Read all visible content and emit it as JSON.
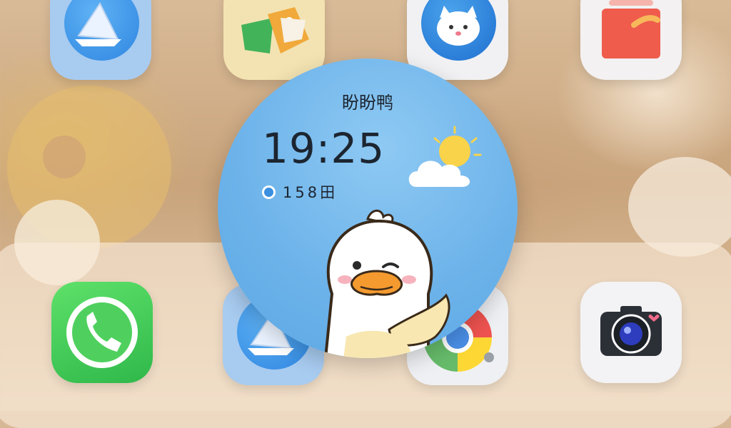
{
  "home": {
    "apps_top": [
      {
        "id": "mail-top",
        "icon": "mail-icon"
      },
      {
        "id": "tag-top",
        "icon": "price-tag-icon"
      },
      {
        "id": "cat-top",
        "icon": "cat-app-icon"
      },
      {
        "id": "gallery-top",
        "icon": "gallery-icon"
      }
    ],
    "dock": [
      {
        "id": "phone",
        "icon": "phone-icon"
      },
      {
        "id": "mail",
        "icon": "mail-icon"
      },
      {
        "id": "browser",
        "icon": "browser-icon"
      },
      {
        "id": "camera",
        "icon": "camera-icon"
      }
    ]
  },
  "widget": {
    "name": "盼盼鸭",
    "time": "19:25",
    "status_text": "158田",
    "weather_icon": "partly-cloudy-icon",
    "character": "duck-illustration"
  },
  "colors": {
    "widget_sky": "#6db3ea",
    "phone_green": "#3cc94f",
    "mail_blue": "#2f86e0"
  }
}
